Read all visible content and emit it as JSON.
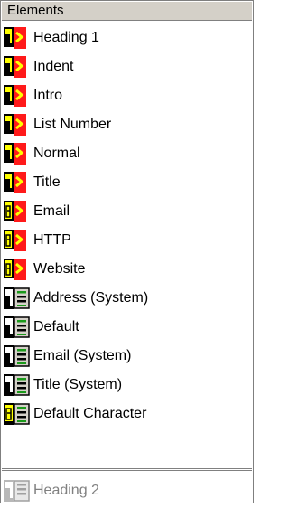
{
  "header": {
    "title": "Elements"
  },
  "items": [
    {
      "label": "Heading 1",
      "icon": "paragraph-style-icon"
    },
    {
      "label": "Indent",
      "icon": "paragraph-style-icon"
    },
    {
      "label": "Intro",
      "icon": "paragraph-style-icon"
    },
    {
      "label": "List Number",
      "icon": "paragraph-style-icon"
    },
    {
      "label": "Normal",
      "icon": "paragraph-style-icon"
    },
    {
      "label": "Title",
      "icon": "paragraph-style-icon"
    },
    {
      "label": "Email",
      "icon": "character-style-icon"
    },
    {
      "label": "HTTP",
      "icon": "character-style-icon"
    },
    {
      "label": "Website",
      "icon": "character-style-icon"
    },
    {
      "label": "Address (System)",
      "icon": "system-paragraph-style-icon"
    },
    {
      "label": "Default",
      "icon": "system-paragraph-style-icon"
    },
    {
      "label": "Email (System)",
      "icon": "system-paragraph-style-icon"
    },
    {
      "label": "Title (System)",
      "icon": "system-paragraph-style-icon"
    },
    {
      "label": "Default Character",
      "icon": "system-character-style-icon"
    }
  ],
  "footer": {
    "label": "Heading 2",
    "icon": "disabled-paragraph-style-icon"
  },
  "colors": {
    "red_tag": "#ff1a1a",
    "yellow_tag": "#ffff00",
    "green_sys": "#1a9a1a",
    "black": "#000000",
    "disabled_gray": "#808080",
    "header_bg": "#d4d0c8"
  }
}
